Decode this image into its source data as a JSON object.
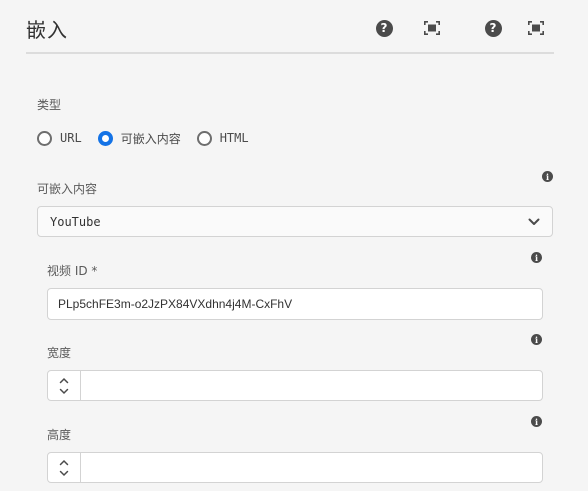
{
  "dialog": {
    "title": "嵌入",
    "header_icons": [
      "help-icon",
      "fullscreen-icon",
      "help-icon",
      "fullscreen-icon"
    ]
  },
  "type_field": {
    "label": "类型",
    "options": [
      {
        "label": "URL",
        "checked": false
      },
      {
        "label": "可嵌入内容",
        "checked": true
      },
      {
        "label": "HTML",
        "checked": false
      }
    ]
  },
  "embeddable": {
    "label": "可嵌入内容",
    "selected": "YouTube"
  },
  "video_id": {
    "label": "视频 ID *",
    "value": "PLp5chFE3m-o2JzPX84VXdhn4j4M-CxFhV"
  },
  "width_field": {
    "label": "宽度",
    "value": ""
  },
  "height_field": {
    "label": "高度",
    "value": ""
  },
  "colors": {
    "accent": "#1473e6",
    "background": "#f5f5f5",
    "border": "#d3d3d3"
  }
}
